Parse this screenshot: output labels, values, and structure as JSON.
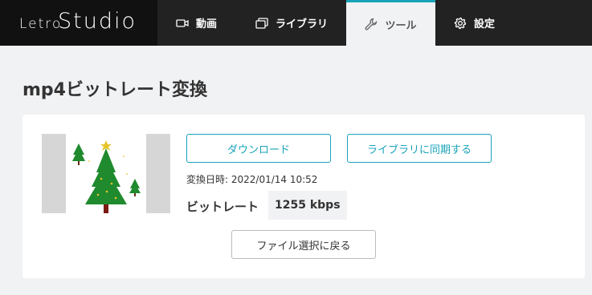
{
  "header": {
    "logo": {
      "prefix": "Letro",
      "main": "Studio"
    },
    "nav": [
      {
        "label": "動画",
        "icon": "video-camera-icon"
      },
      {
        "label": "ライブラリ",
        "icon": "library-icon"
      },
      {
        "label": "ツール",
        "icon": "wrench-icon",
        "active": true
      },
      {
        "label": "設定",
        "icon": "gear-icon"
      }
    ]
  },
  "main": {
    "title": "mp4ビットレート変換",
    "download_label": "ダウンロード",
    "sync_label": "ライブラリに同期する",
    "date_text": "変換日時: 2022/01/14 10:52",
    "bitrate_label": "ビットレート",
    "bitrate_value": "1255 kbps",
    "back_label": "ファイル選択に戻る"
  },
  "colors": {
    "accent": "#19a3b9",
    "header_bg": "#222222",
    "page_bg": "#f1f2f4"
  }
}
